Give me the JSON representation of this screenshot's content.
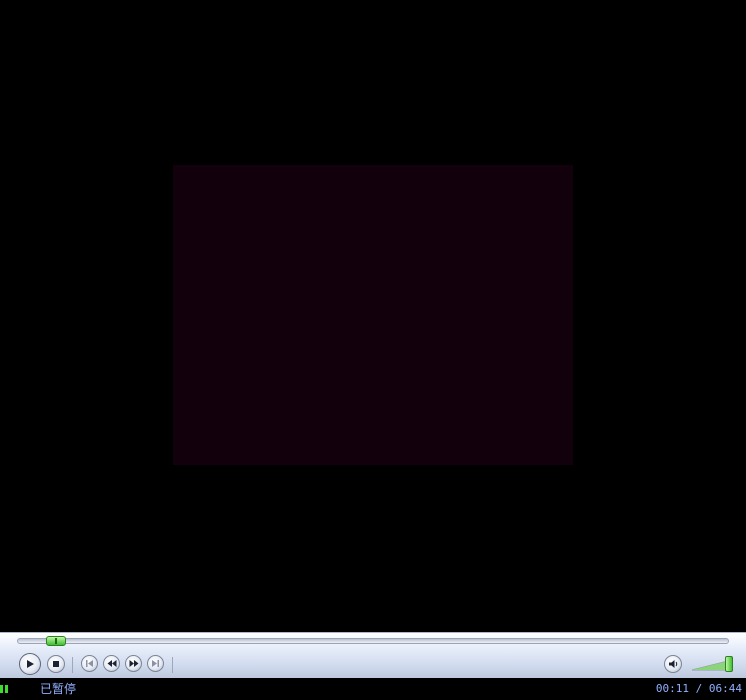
{
  "player": {
    "status": "已暂停",
    "current_time": "00:11",
    "time_separator": "/",
    "duration": "06:44",
    "seek_progress": 0.03,
    "volume_level": 0.95
  },
  "icons": {
    "status": "pause-icon",
    "play": "play-icon",
    "stop": "stop-icon",
    "previous": "previous-track-icon",
    "rewind": "rewind-icon",
    "fast_forward": "fast-forward-icon",
    "next": "next-track-icon",
    "mute": "speaker-icon"
  },
  "colors": {
    "video_frame": "#12000d",
    "accent_green": "#3ddc2f",
    "status_text": "#8fb0ff"
  }
}
